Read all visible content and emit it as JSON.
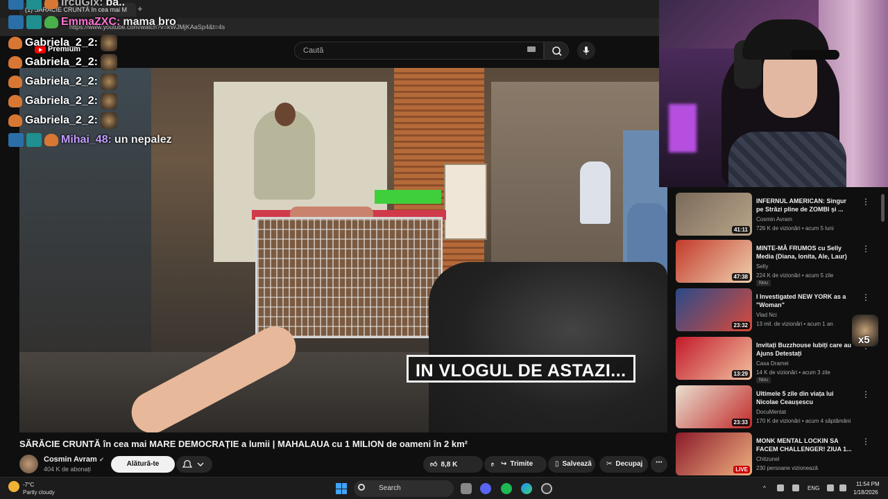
{
  "browser": {
    "tab_title": "(1) SĂRĂCIE CRUNTĂ în cea mai M",
    "url": "https://www.youtube.com/watch?v=kWJMjKAaSp4&t=4s"
  },
  "youtube": {
    "logo_label": "Premium",
    "search_placeholder": "Caută"
  },
  "chat": [
    {
      "user": "IrcuGix:",
      "message": "ba..",
      "color": "gray"
    },
    {
      "user": "EmmaZXC:",
      "message": "mama bro",
      "color": "pink"
    },
    {
      "user": "Gabriela_2_2:",
      "message": "",
      "color": "white"
    },
    {
      "user": "Gabriela_2_2:",
      "message": "",
      "color": "white"
    },
    {
      "user": "Gabriela_2_2:",
      "message": "",
      "color": "white"
    },
    {
      "user": "Gabriela_2_2:",
      "message": "",
      "color": "white"
    },
    {
      "user": "Gabriela_2_2:",
      "message": "",
      "color": "white"
    },
    {
      "user": "Mihai_48:",
      "message": "un nepalez",
      "color": "purple"
    }
  ],
  "video": {
    "caption": "IN VLOGUL DE ASTAZI...",
    "title": "SĂRĂCIE CRUNTĂ în cea mai MARE DEMOCRAȚIE a lumii | MAHALAUA cu 1 MILION de oameni în 2 km²",
    "channel_name": "Cosmin Avram",
    "subscribers": "404 K de abonați",
    "join_label": "Alătură-te",
    "likes": "8,8 K",
    "share_label": "Trimite",
    "save_label": "Salvează",
    "clip_label": "Decupaj"
  },
  "recommendations": [
    {
      "title": "INFERNUL AMERICAN: Singur pe Străzi pline de ZOMBI și ...",
      "channel": "Cosmin Avram",
      "meta": "726 K de vizionări • acum 5 luni",
      "duration": "41:11",
      "badge": "",
      "colors": [
        "#7a6a5a",
        "#b9a58a"
      ]
    },
    {
      "title": "MINTE-MĂ FRUMOS cu Selly Media (Diana, Ionita, Ale, Laur)",
      "channel": "Selly",
      "meta": "224 K de vizionări • acum 5 zile",
      "duration": "47:38",
      "badge": "Nou",
      "colors": [
        "#c23a2a",
        "#f0d0b0"
      ]
    },
    {
      "title": "I Investigated NEW YORK as a \"Woman\"",
      "channel": "Vlad Nci",
      "meta": "13 mil. de vizionări • acum 1 an",
      "duration": "23:32",
      "badge": "",
      "colors": [
        "#2a4a8a",
        "#d84a3a"
      ]
    },
    {
      "title": "Invitați Buzzhouse Iubiți care au Ajuns Detestați",
      "channel": "Casa Dramei",
      "meta": "14 K de vizionări • acum 3 zile",
      "duration": "13:29",
      "badge": "Nou",
      "colors": [
        "#c21a2a",
        "#f2c0a0"
      ]
    },
    {
      "title": "Ultimele 5 zile din viața lui Nicolae Ceaușescu",
      "channel": "DocuMentat",
      "meta": "170 K de vizionări • acum 4 săptămâni",
      "duration": "23:33",
      "badge": "",
      "colors": [
        "#e8e0d0",
        "#c22a2a"
      ]
    },
    {
      "title": "MONK MENTAL LOCKIN SA FACEM CHALLENGER! ZIUA 1...",
      "channel": "Chitzunel",
      "meta": "230 persoane vizionează",
      "duration": "LIVE",
      "badge": "",
      "colors": [
        "#8a1a2a",
        "#f0b080"
      ]
    }
  ],
  "side_emote_label": "x5",
  "taskbar": {
    "temperature": "-7°C",
    "weather": "Partly cloudy",
    "search_label": "Search",
    "language": "ENG",
    "time": "11:54 PM",
    "date": "1/18/2026"
  }
}
